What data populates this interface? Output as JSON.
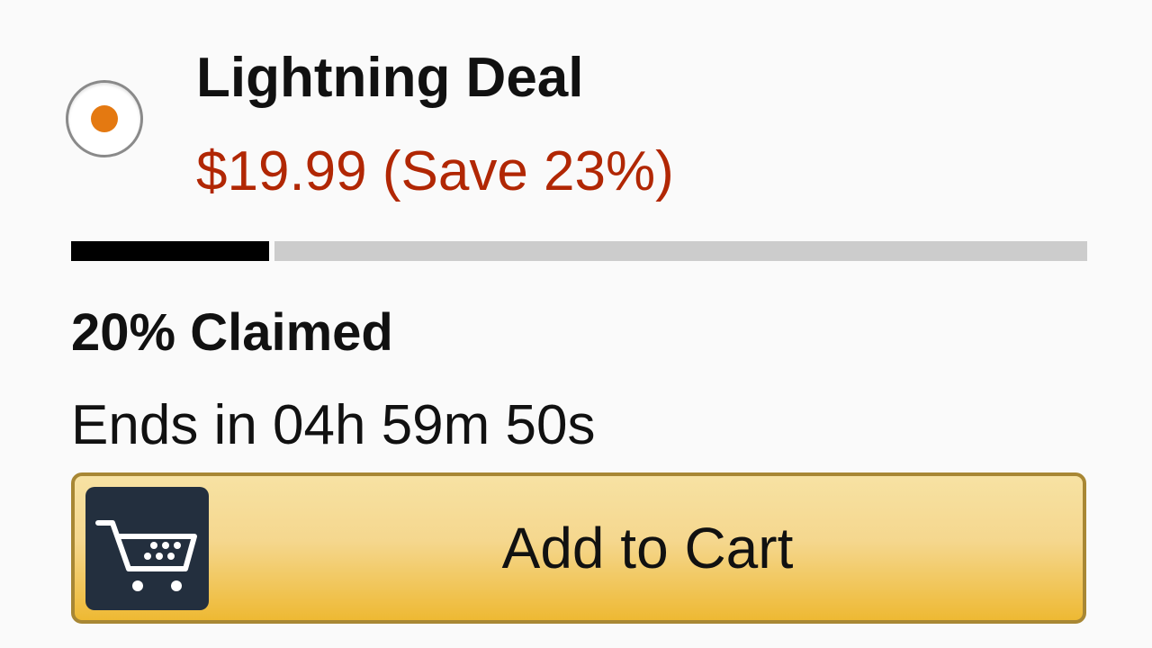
{
  "deal": {
    "title": "Lightning Deal",
    "price_text": "$19.99 (Save 23%)",
    "radio_selected": true,
    "claimed_fraction": 0.2,
    "claimed_text": "20% Claimed",
    "ends_text": "Ends in 04h 59m 50s"
  },
  "button": {
    "label": "Add to Cart",
    "icon": "shopping-cart-icon"
  },
  "colors": {
    "price": "#b12704",
    "radio_dot": "#e47911",
    "progress_fill": "#000000",
    "progress_track": "#cccccc",
    "button_border": "#a88734",
    "button_top": "#f7e2a3",
    "button_bottom": "#eeb933",
    "icon_bg": "#232f3e"
  }
}
